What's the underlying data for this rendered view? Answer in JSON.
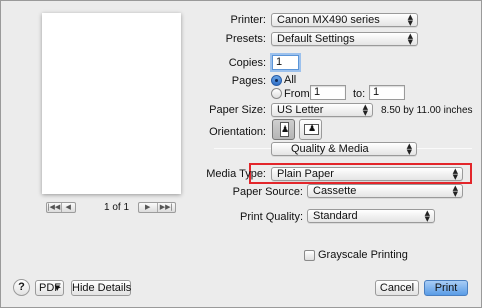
{
  "preview": {
    "page_info": "1 of 1",
    "nav_first_prev": [
      "|◀◀",
      "◀"
    ],
    "nav_next_last": [
      "▶",
      "▶▶|"
    ]
  },
  "printer": {
    "label": "Printer:",
    "value": "Canon MX490 series"
  },
  "presets": {
    "label": "Presets:",
    "value": "Default Settings"
  },
  "copies": {
    "label": "Copies:",
    "value": "1"
  },
  "pages": {
    "label": "Pages:",
    "all_label": "All",
    "from_label": "From:",
    "from_value": "1",
    "to_label": "to:",
    "to_value": "1",
    "selected": "All"
  },
  "paper_size": {
    "label": "Paper Size:",
    "value": "US Letter",
    "dimensions": "8.50 by 11.00 inches"
  },
  "orientation": {
    "label": "Orientation:",
    "selected": "portrait"
  },
  "section_popup": {
    "value": "Quality & Media"
  },
  "media_type": {
    "label": "Media Type:",
    "value": "Plain Paper"
  },
  "paper_source": {
    "label": "Paper Source:",
    "value": "Cassette"
  },
  "print_quality": {
    "label": "Print Quality:",
    "value": "Standard"
  },
  "grayscale": {
    "label": "Grayscale Printing",
    "checked": false
  },
  "footer": {
    "help": "?",
    "pdf_label": "PDF",
    "hide_details_label": "Hide Details",
    "cancel_label": "Cancel",
    "print_label": "Print"
  },
  "colors": {
    "highlight": "#e3262b",
    "accent": "#5a9ce6"
  }
}
